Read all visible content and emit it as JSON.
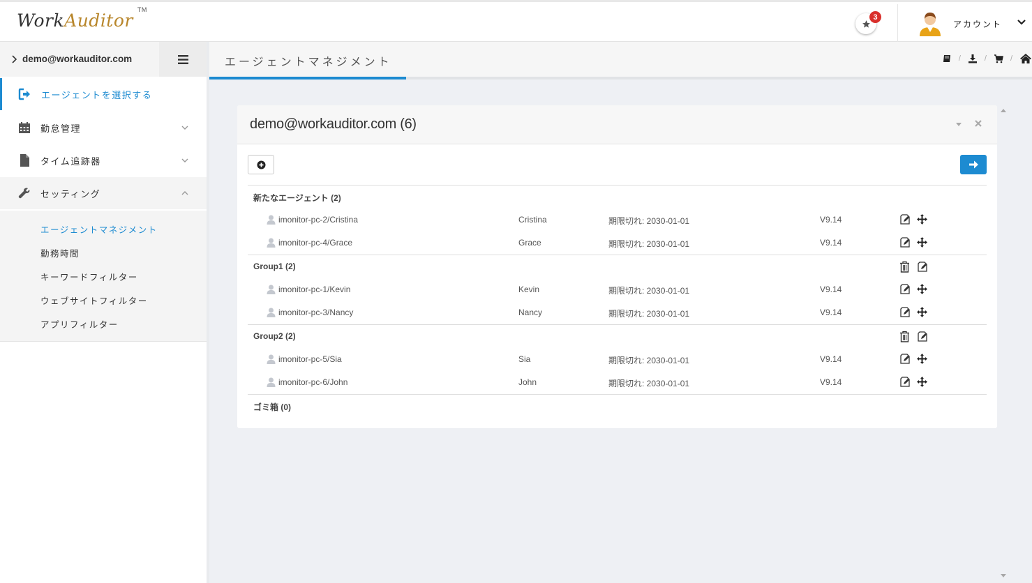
{
  "header": {
    "logo_work": "Work",
    "logo_auditor": "Auditor",
    "logo_tm": "TM",
    "notification_count": "3",
    "account_label": "アカウント"
  },
  "sidebar": {
    "user_email": "demo@workauditor.com",
    "items": [
      {
        "label": "エージェントを選択する",
        "icon": "sign-out-icon",
        "active": true
      },
      {
        "label": "勤怠管理",
        "icon": "calendar-icon"
      },
      {
        "label": "タイム追跡器",
        "icon": "file-icon"
      },
      {
        "label": "セッティング",
        "icon": "wrench-icon",
        "expanded": true
      }
    ],
    "settings_submenu": [
      {
        "label": "エージェントマネジメント",
        "active": true
      },
      {
        "label": "勤務時間"
      },
      {
        "label": "キーワードフィルター"
      },
      {
        "label": "ウェブサイトフィルター"
      },
      {
        "label": "アプリフィルター"
      }
    ]
  },
  "page": {
    "title": "エージェントマネジメント",
    "breadcrumb_icons": [
      "book-icon",
      "download-icon",
      "cart-icon",
      "home-icon"
    ]
  },
  "portlet": {
    "title": "demo@workauditor.com (6)",
    "groups": [
      {
        "label": "新たなエージェント (2)",
        "agents": [
          {
            "host": "imonitor-pc-2/Cristina",
            "name": "Cristina",
            "expiry": "期限切れ: 2030-01-01",
            "version": "V9.14"
          },
          {
            "host": "imonitor-pc-4/Grace",
            "name": "Grace",
            "expiry": "期限切れ: 2030-01-01",
            "version": "V9.14"
          }
        ]
      },
      {
        "label": "Group1 (2)",
        "agents": [
          {
            "host": "imonitor-pc-1/Kevin",
            "name": "Kevin",
            "expiry": "期限切れ: 2030-01-01",
            "version": "V9.14"
          },
          {
            "host": "imonitor-pc-3/Nancy",
            "name": "Nancy",
            "expiry": "期限切れ: 2030-01-01",
            "version": "V9.14"
          }
        ]
      },
      {
        "label": "Group2 (2)",
        "agents": [
          {
            "host": "imonitor-pc-5/Sia",
            "name": "Sia",
            "expiry": "期限切れ: 2030-01-01",
            "version": "V9.14"
          },
          {
            "host": "imonitor-pc-6/John",
            "name": "John",
            "expiry": "期限切れ: 2030-01-01",
            "version": "V9.14"
          }
        ]
      },
      {
        "label": "ゴミ箱 (0)",
        "agents": []
      }
    ]
  },
  "colors": {
    "accent": "#1d8bd1",
    "badge": "#d9302c",
    "brand_gold": "#b8862b"
  }
}
